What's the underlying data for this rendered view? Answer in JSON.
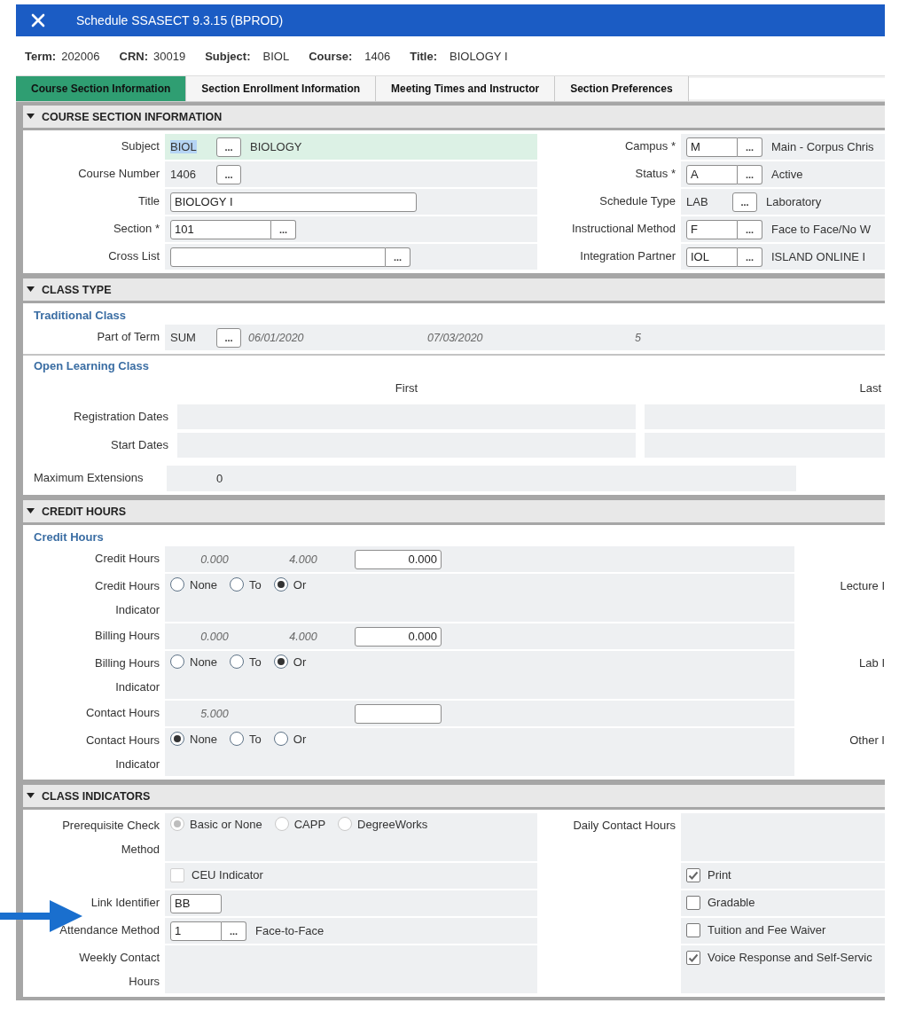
{
  "window": {
    "title": "Schedule SSASECT 9.3.15 (BPROD)"
  },
  "key_block": [
    {
      "label": "Term:",
      "value": "202006"
    },
    {
      "label": "CRN:",
      "value": "30019"
    },
    {
      "label": "Subject:",
      "value": "BIOL"
    },
    {
      "label": "Course:",
      "value": "1406"
    },
    {
      "label": "Title:",
      "value": "BIOLOGY I"
    }
  ],
  "tabs": [
    {
      "label": "Course Section Information",
      "selected": true
    },
    {
      "label": "Section Enrollment Information",
      "selected": false
    },
    {
      "label": "Meeting Times and Instructor",
      "selected": false
    },
    {
      "label": "Section Preferences",
      "selected": false
    }
  ],
  "sections": [
    {
      "kind": "pairs",
      "title": "COURSE SECTION INFORMATION",
      "expanded": true,
      "rows": [
        {
          "left": {
            "label": "Subject",
            "field": {
              "kind": "plain",
              "value": "BIOL",
              "highlighted": true,
              "focused": true,
              "lookup": "...",
              "description": "BIOLOGY"
            }
          },
          "right": {
            "label": "Campus *",
            "field": {
              "kind": "code",
              "value": "M",
              "lookup": "...",
              "description": "Main - Corpus Chris"
            }
          }
        },
        {
          "left": {
            "label": "Course Number",
            "field": {
              "kind": "plain",
              "value": "1406",
              "highlighted": false,
              "focused": false,
              "lookup": "..."
            }
          },
          "right": {
            "label": "Status *",
            "field": {
              "kind": "code",
              "value": "A",
              "lookup": "...",
              "description": "Active"
            }
          }
        },
        {
          "left": {
            "label": "Title",
            "field": {
              "kind": "text",
              "value": "BIOLOGY I"
            }
          },
          "right": {
            "label": "Schedule Type",
            "field": {
              "kind": "plain",
              "value": "LAB",
              "highlighted": false,
              "focused": false,
              "lookup": "...",
              "description": "Laboratory"
            }
          }
        },
        {
          "left": {
            "label": "Section *",
            "field": {
              "kind": "code_long",
              "value": "101",
              "lookup": "..."
            }
          },
          "right": {
            "label": "Instructional Method",
            "field": {
              "kind": "code",
              "value": "F",
              "lookup": "...",
              "description": "Face to Face/No W"
            }
          }
        },
        {
          "left": {
            "label": "Cross List",
            "field": {
              "kind": "code_wide",
              "lookup": "..."
            }
          },
          "right": {
            "label": "Integration Partner",
            "field": {
              "kind": "code",
              "value": "IOL",
              "lookup": "...",
              "description": "ISLAND ONLINE I"
            }
          }
        }
      ]
    },
    {
      "kind": "class_type",
      "title": "CLASS TYPE",
      "expanded": true,
      "traditional": {
        "heading": "Traditional Class",
        "label": "Part of Term",
        "value": "SUM",
        "lookup": "...",
        "start_date": "06/01/2020",
        "end_date": "07/03/2020",
        "weeks": "5"
      },
      "open_learning": {
        "heading": "Open Learning Class",
        "columns": [
          "First",
          "Last"
        ],
        "rows": [
          {
            "label": "Registration Dates"
          },
          {
            "label": "Start Dates"
          }
        ],
        "max_extensions": {
          "label": "Maximum Extensions",
          "value": "0"
        }
      }
    },
    {
      "kind": "credit",
      "title": "CREDIT HOURS",
      "expanded": true,
      "heading": "Credit Hours",
      "rows": [
        {
          "label": "Credit Hours",
          "field": {
            "kind": "range",
            "values": [
              "0.000",
              "4.000"
            ],
            "amount": "0.000"
          }
        },
        {
          "label": "Credit Hours Indicator",
          "side_label": "Lecture I",
          "field": {
            "kind": "radios",
            "disabled": false,
            "options": [
              {
                "label": "None",
                "selected": false
              },
              {
                "label": "To",
                "selected": false
              },
              {
                "label": "Or",
                "selected": true
              }
            ]
          }
        },
        {
          "label": "Billing Hours",
          "field": {
            "kind": "range",
            "values": [
              "0.000",
              "4.000"
            ],
            "amount": "0.000"
          }
        },
        {
          "label": "Billing Hours Indicator",
          "side_label": "Lab I",
          "field": {
            "kind": "radios",
            "disabled": false,
            "options": [
              {
                "label": "None",
                "selected": false
              },
              {
                "label": "To",
                "selected": false
              },
              {
                "label": "Or",
                "selected": true
              }
            ]
          }
        },
        {
          "label": "Contact Hours",
          "field": {
            "kind": "range",
            "values": [
              "5.000"
            ]
          }
        },
        {
          "label": "Contact Hours Indicator",
          "side_label": "Other I",
          "field": {
            "kind": "radios",
            "disabled": false,
            "options": [
              {
                "label": "None",
                "selected": true
              },
              {
                "label": "To",
                "selected": false
              },
              {
                "label": "Or",
                "selected": false
              }
            ]
          }
        }
      ]
    },
    {
      "kind": "pairs",
      "title": "CLASS INDICATORS",
      "expanded": true,
      "rows": [
        {
          "left": {
            "label": "Prerequisite Check Method",
            "field": {
              "kind": "radios",
              "disabled": true,
              "options": [
                {
                  "label": "Basic or None",
                  "selected": true
                },
                {
                  "label": "CAPP",
                  "selected": false
                },
                {
                  "label": "DegreeWorks",
                  "selected": false
                }
              ]
            }
          },
          "right": {
            "label": "Daily Contact Hours",
            "field": {
              "kind": "empty"
            }
          }
        },
        {
          "left": {
            "field": {
              "kind": "checkbox",
              "label": "CEU Indicator",
              "checked": false,
              "disabled": true
            }
          },
          "right": {
            "field": {
              "kind": "checkbox",
              "label": "Print",
              "checked": true,
              "disabled": false
            }
          }
        },
        {
          "left": {
            "label": "Link Identifier",
            "field": {
              "kind": "short_text",
              "value": "BB"
            }
          },
          "right": {
            "field": {
              "kind": "checkbox",
              "label": "Gradable",
              "checked": false,
              "disabled": false
            }
          }
        },
        {
          "left": {
            "label": "Attendance Method",
            "field": {
              "kind": "code",
              "value": "1",
              "lookup": "...",
              "description": "Face-to-Face"
            }
          },
          "right": {
            "field": {
              "kind": "checkbox",
              "label": "Tuition and Fee Waiver",
              "checked": false,
              "disabled": false
            }
          }
        },
        {
          "left": {
            "label": "Weekly Contact Hours",
            "field": {
              "kind": "empty"
            }
          },
          "right": {
            "field": {
              "kind": "checkbox",
              "label": "Voice Response and Self-Servic",
              "checked": true,
              "disabled": false
            }
          }
        }
      ]
    }
  ]
}
